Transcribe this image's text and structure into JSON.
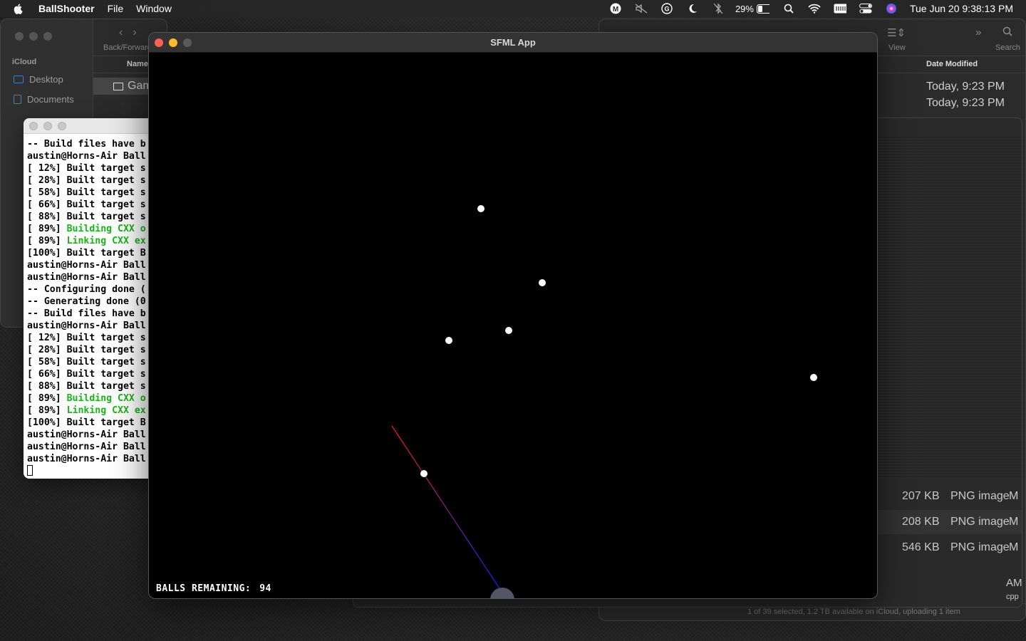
{
  "menubar": {
    "app_name": "BallShooter",
    "menus": [
      "File",
      "Window"
    ],
    "battery_percent": "29%",
    "clock": "Tue Jun 20  9:38:13 PM"
  },
  "finder_left": {
    "sidebar_section": "iCloud",
    "sidebar_items": [
      "Desktop",
      "Documents"
    ],
    "nav_label": "Back/Forward",
    "column_name": "Name",
    "file_name": "Gam"
  },
  "finder_right": {
    "toolbar_view_label": "View",
    "toolbar_search_label": "Search",
    "date_header": "Date Modified",
    "dates": [
      "Today, 9:23 PM",
      "Today, 9:23 PM"
    ],
    "status": "1 of 39 selected, 1.2 TB available on iCloud, uploading 1 item"
  },
  "preview": {
    "rows": [
      {
        "size": "207 KB",
        "kind": "PNG image",
        "tail": "M"
      },
      {
        "size": "208 KB",
        "kind": "PNG image",
        "tail": "M"
      },
      {
        "size": "546 KB",
        "kind": "PNG image",
        "tail": "M"
      }
    ],
    "extra_tail": [
      "AM",
      "cpp"
    ]
  },
  "terminal": {
    "lines": [
      {
        "text": "-- Build files have b",
        "color": "default"
      },
      {
        "text": "austin@Horns-Air Ball",
        "color": "default"
      },
      {
        "text": "[ 12%] Built target s",
        "color": "default"
      },
      {
        "text": "[ 28%] Built target s",
        "color": "default"
      },
      {
        "text": "[ 58%] Built target s",
        "color": "default"
      },
      {
        "text": "[ 66%] Built target s",
        "color": "default"
      },
      {
        "text": "[ 88%] Built target s",
        "color": "default"
      },
      {
        "prefix": "[ 89%] ",
        "text": "Building CXX o",
        "color": "green"
      },
      {
        "prefix": "[ 89%] ",
        "text": "Linking CXX ex",
        "color": "green"
      },
      {
        "text": "[100%] Built target B",
        "color": "default"
      },
      {
        "text": "austin@Horns-Air Ball",
        "color": "default"
      },
      {
        "text": "austin@Horns-Air Ball",
        "color": "default"
      },
      {
        "text": "-- Configuring done (",
        "color": "default"
      },
      {
        "text": "-- Generating done (0",
        "color": "default"
      },
      {
        "text": "-- Build files have b",
        "color": "default"
      },
      {
        "text": "austin@Horns-Air Ball",
        "color": "default"
      },
      {
        "text": "[ 12%] Built target s",
        "color": "default"
      },
      {
        "text": "[ 28%] Built target s",
        "color": "default"
      },
      {
        "text": "[ 58%] Built target s",
        "color": "default"
      },
      {
        "text": "[ 66%] Built target s",
        "color": "default"
      },
      {
        "text": "[ 88%] Built target s",
        "color": "default"
      },
      {
        "prefix": "[ 89%] ",
        "text": "Building CXX o",
        "color": "green"
      },
      {
        "prefix": "[ 89%] ",
        "text": "Linking CXX ex",
        "color": "green"
      },
      {
        "text": "[100%] Built target B",
        "color": "default"
      },
      {
        "text": "austin@Horns-Air Ball",
        "color": "default"
      },
      {
        "text": "austin@Horns-Air Ball",
        "color": "default"
      },
      {
        "text": "austin@Horns-Air Ball",
        "color": "default"
      }
    ]
  },
  "sfml": {
    "title": "SFML App",
    "hud_label": "BALLS REMAINING:",
    "balls_remaining": "94",
    "colors": {
      "ball": "#ffffff",
      "aim_start": "#ff1a1a",
      "aim_end": "#1a1aff",
      "cannon": "#555566"
    }
  }
}
